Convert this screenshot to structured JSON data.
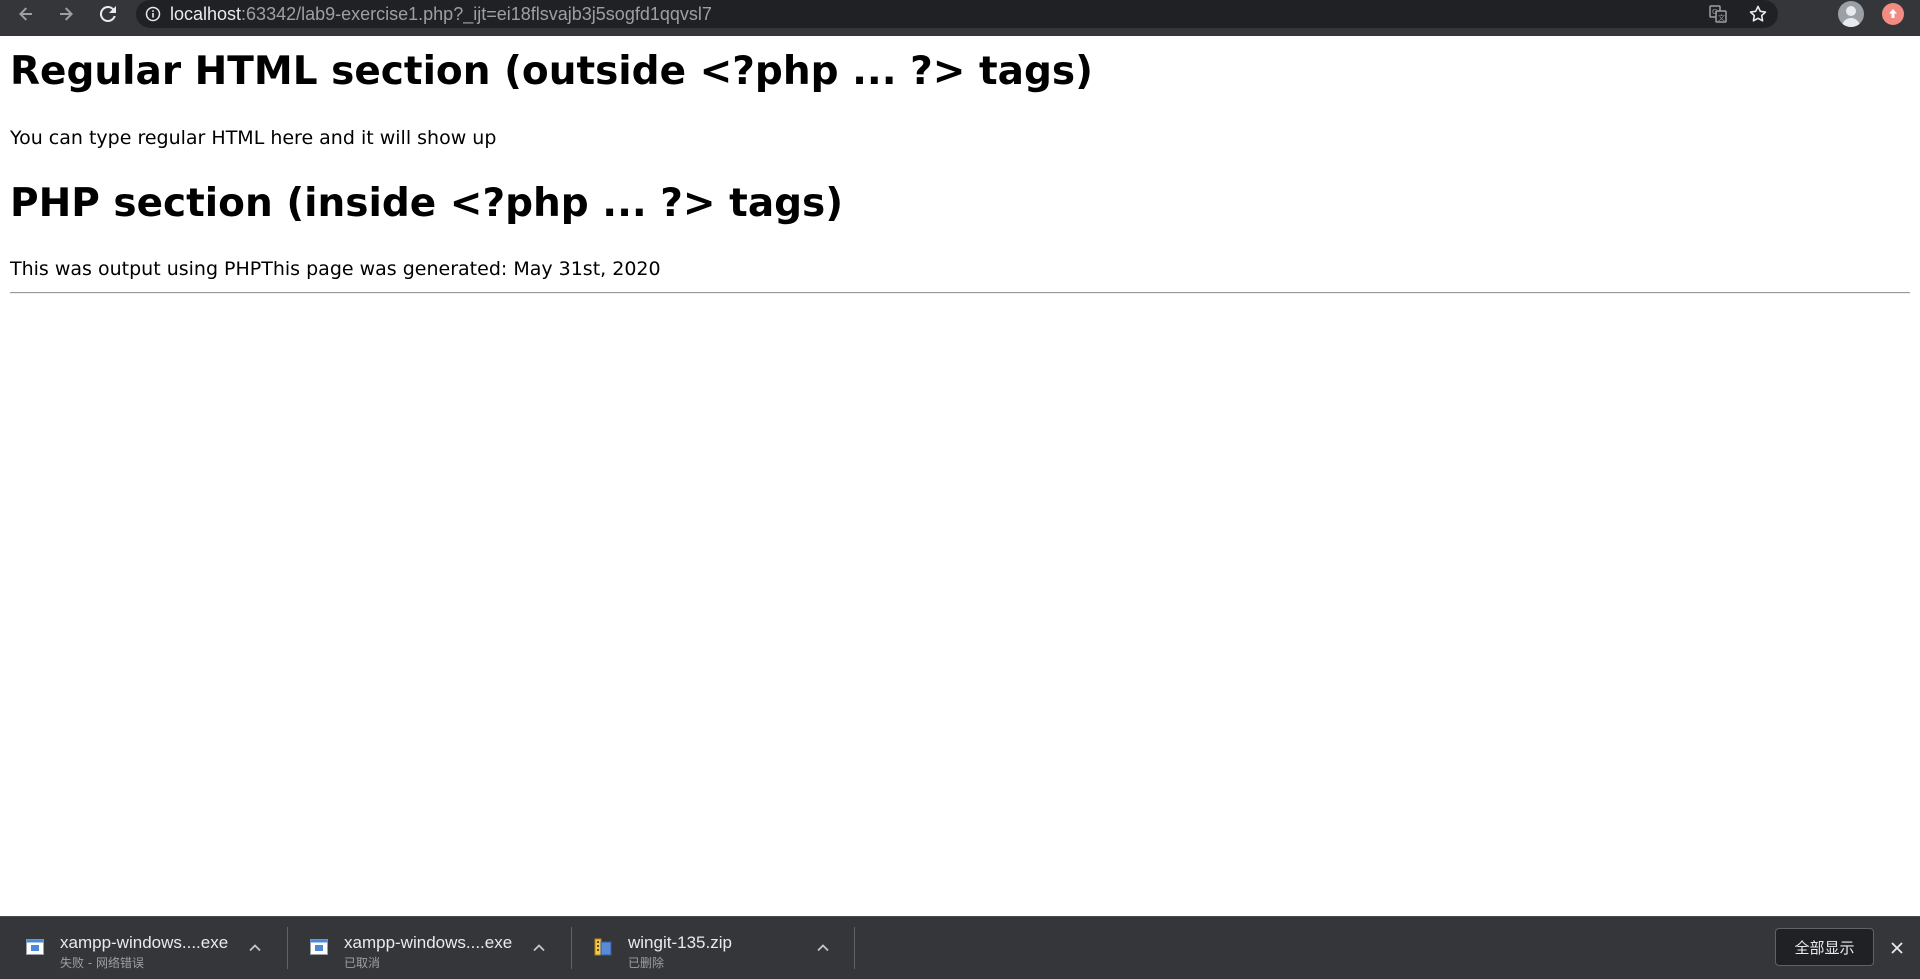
{
  "browser": {
    "url_host": "localhost",
    "url_rest": ":63342/lab9-exercise1.php?_ijt=ei18flsvajb3j5sogfd1qqvsl7",
    "icons": [
      "back-icon",
      "forward-icon",
      "reload-icon",
      "site-info-icon",
      "translate-icon",
      "star-icon",
      "profile-icon",
      "update-icon"
    ]
  },
  "page": {
    "heading1": "Regular HTML section (outside <?php ... ?> tags)",
    "paragraph1": "You can type regular HTML here and it will show up",
    "heading2": "PHP section (inside <?php ... ?> tags)",
    "paragraph2": "This was output using PHPThis page was generated: May 31st, 2020"
  },
  "downloads": {
    "items": [
      {
        "name": "xampp-windows....exe",
        "status": "失败 - 网络错误",
        "icon": "installer-icon"
      },
      {
        "name": "xampp-windows....exe",
        "status": "已取消",
        "icon": "installer-icon"
      },
      {
        "name": "wingit-135.zip",
        "status": "已删除",
        "icon": "zip-icon"
      }
    ],
    "show_all_label": "全部显示"
  },
  "colors": {
    "toolbar_bg": "#35363a",
    "omnibox_bg": "#202124",
    "update_badge": "#f28b82"
  }
}
